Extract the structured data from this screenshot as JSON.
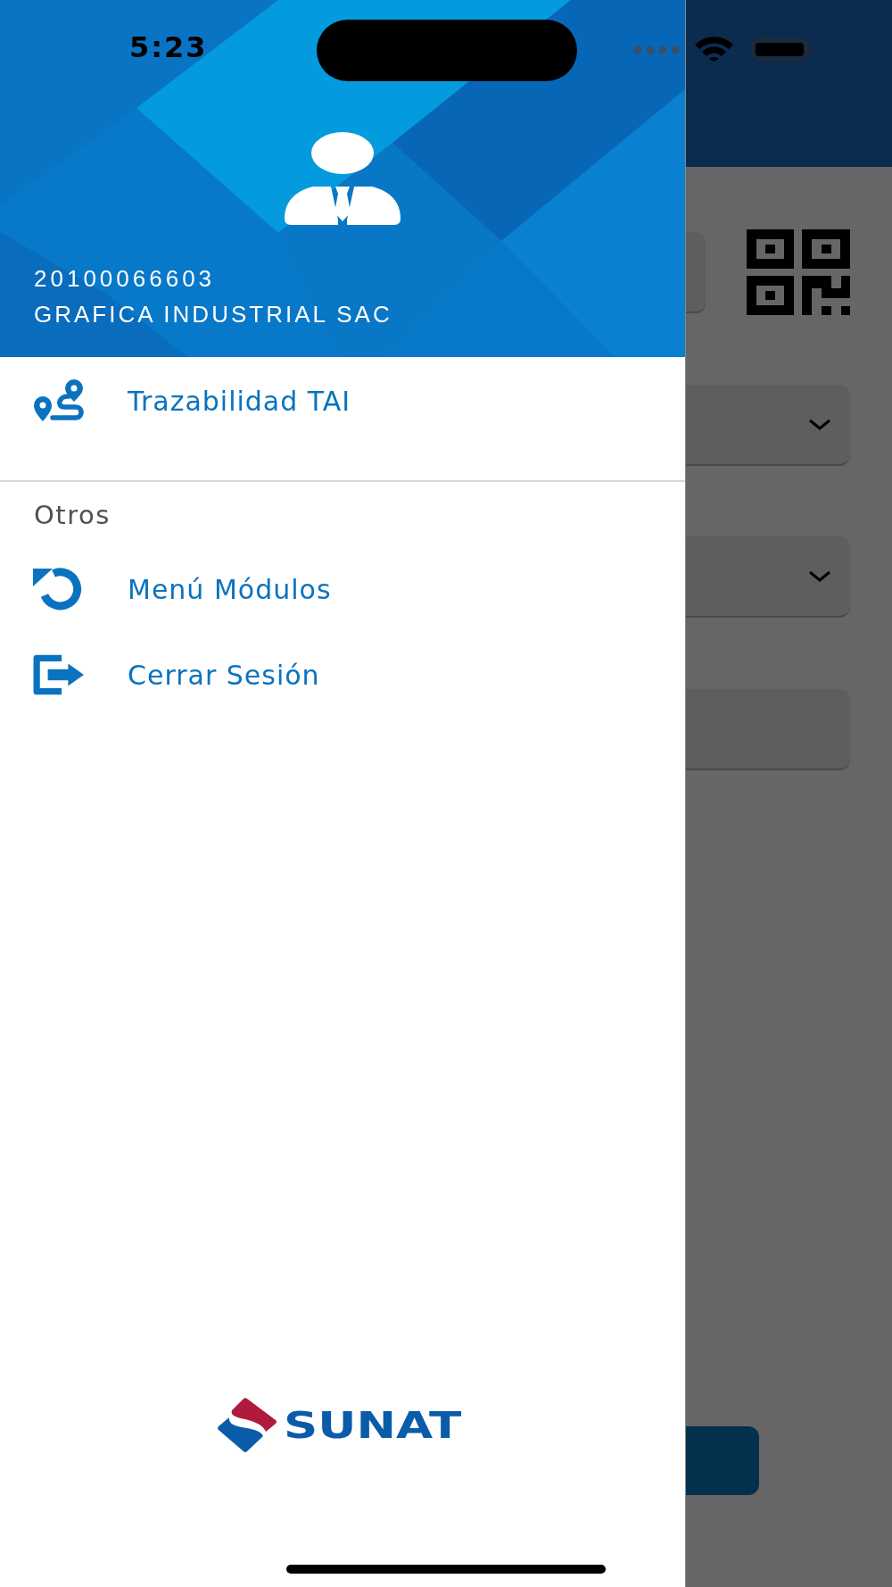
{
  "status_bar": {
    "time": "5:23"
  },
  "profile": {
    "ruc": "20100066603",
    "name": "GRAFICA INDUSTRIAL SAC"
  },
  "menu_sections": [
    {
      "items": [
        {
          "label": "Trazabilidad TAI"
        }
      ]
    },
    {
      "title": "Otros",
      "items": [
        {
          "label": "Menú Módulos"
        },
        {
          "label": "Cerrar Sesión"
        }
      ]
    }
  ],
  "logo": {
    "text": "SUNAT"
  }
}
